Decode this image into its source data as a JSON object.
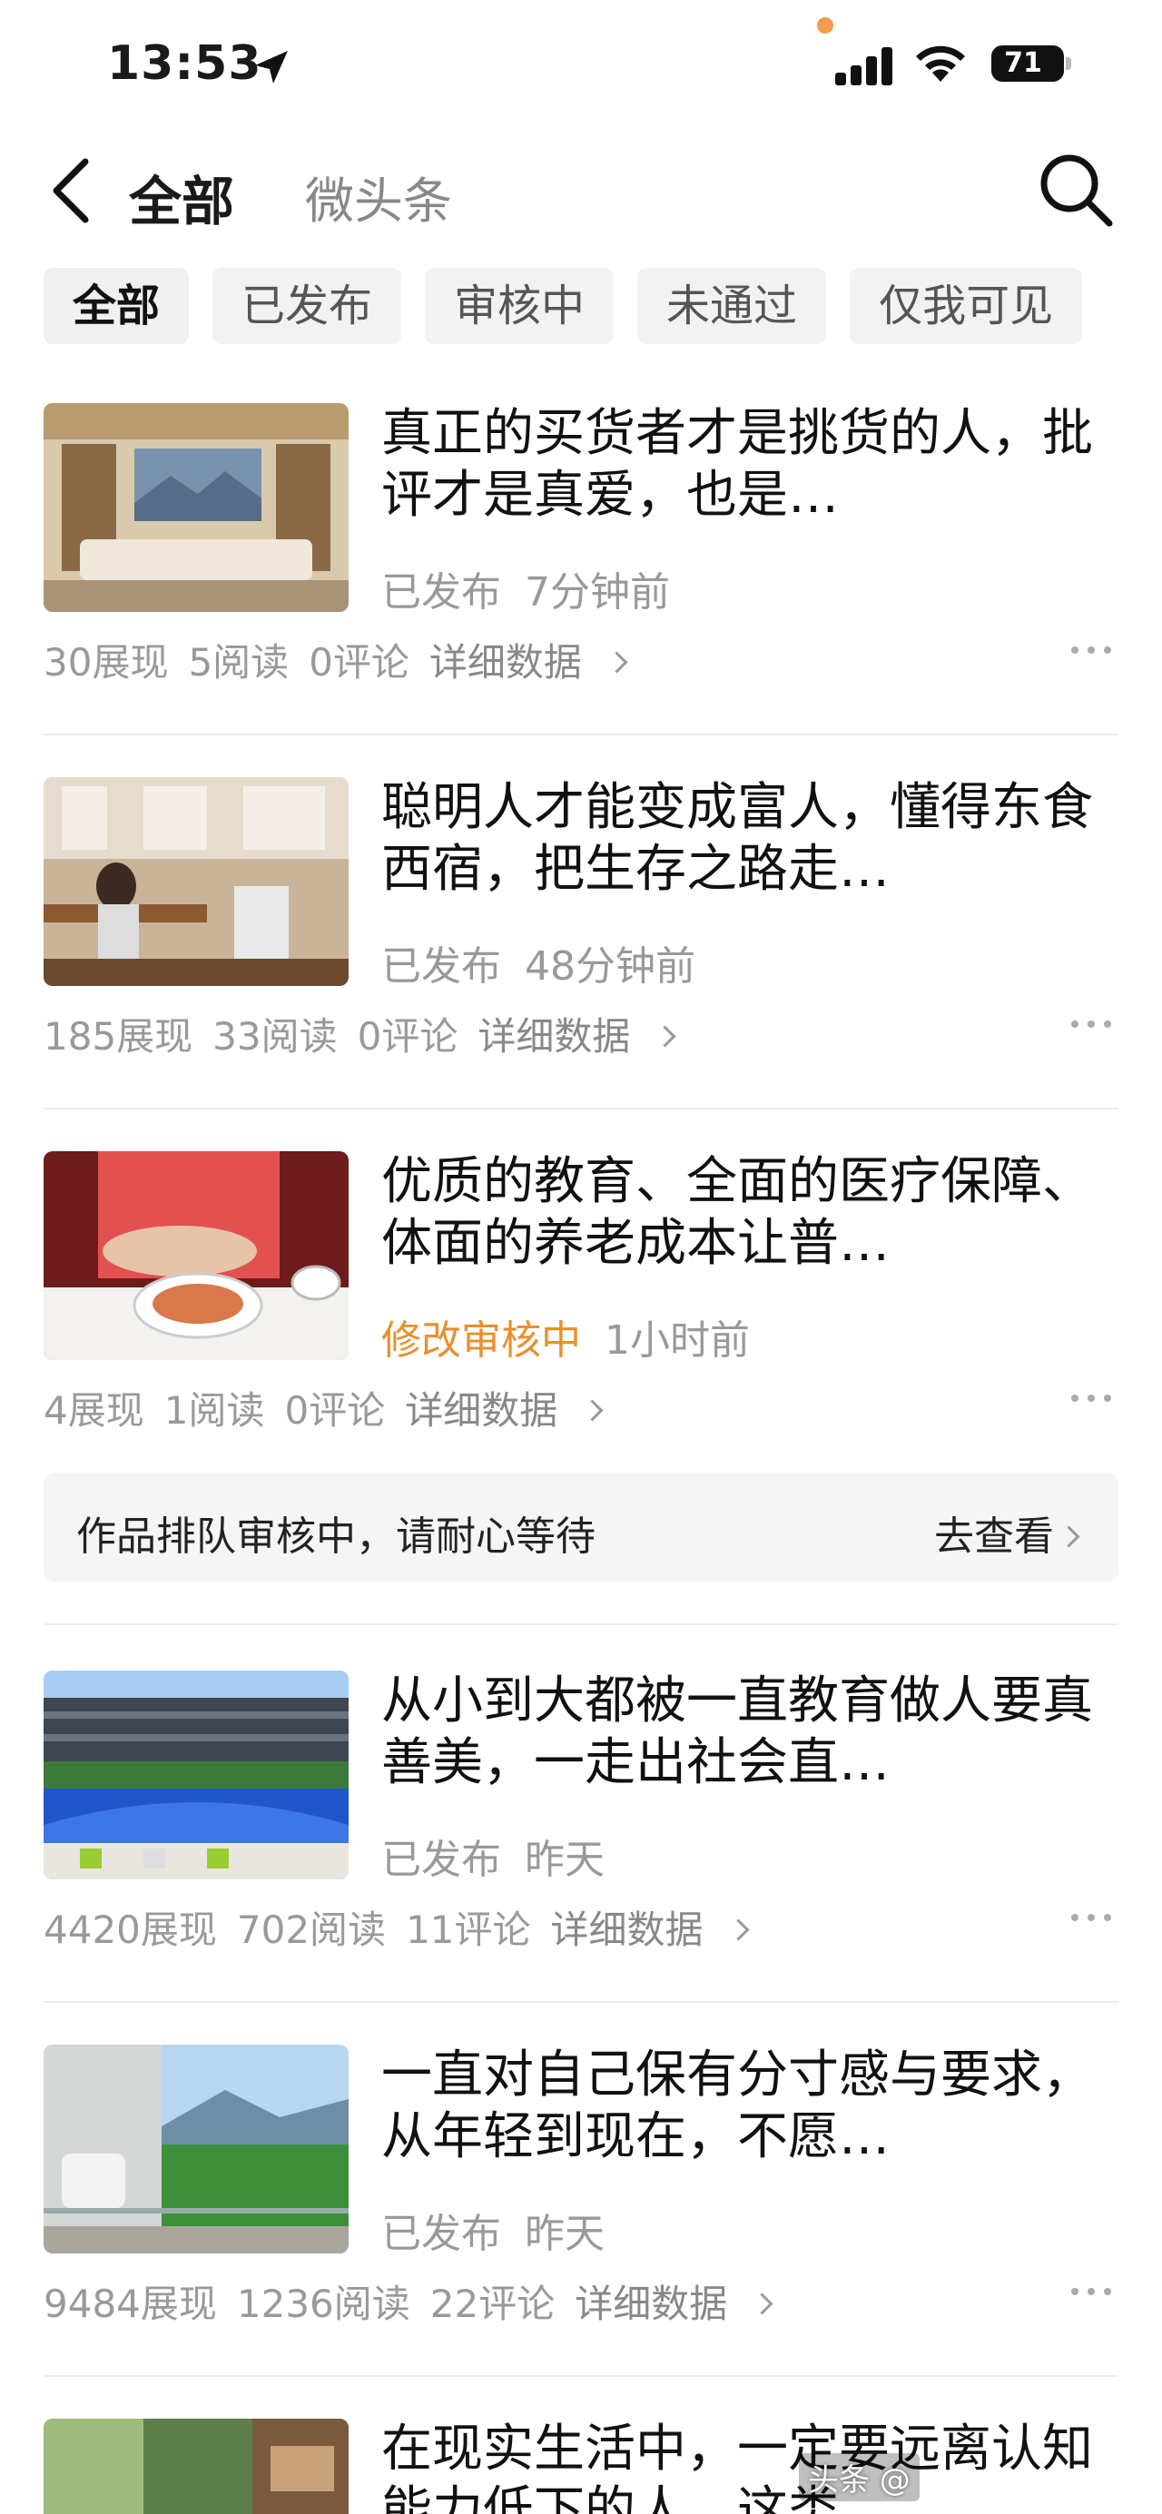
{
  "status_bar": {
    "time": "13:53",
    "battery": "71"
  },
  "header": {
    "title": "全部",
    "subtitle": "微头条"
  },
  "tabs": [
    "全部",
    "已发布",
    "审核中",
    "未通过",
    "仅我可见"
  ],
  "articles": [
    {
      "title": "真正的买货者才是挑货的人，批评才是真爱，也是…",
      "status": "已发布",
      "time": "7分钟前",
      "impressions": "30展现",
      "reads": "5阅读",
      "comments": "0评论",
      "detail": "详细数据"
    },
    {
      "title": "聪明人才能变成富人，懂得东食西宿，把生存之路走…",
      "status": "已发布",
      "time": "48分钟前",
      "impressions": "185展现",
      "reads": "33阅读",
      "comments": "0评论",
      "detail": "详细数据"
    },
    {
      "title": "优质的教育、全面的医疗保障、体面的养老成本让普…",
      "status": "修改审核中",
      "time": "1小时前",
      "impressions": "4展现",
      "reads": "1阅读",
      "comments": "0评论",
      "detail": "详细数据"
    },
    {
      "title": "从小到大都被一直教育做人要真善美，一走出社会直…",
      "status": "已发布",
      "time": "昨天",
      "impressions": "4420展现",
      "reads": "702阅读",
      "comments": "11评论",
      "detail": "详细数据"
    },
    {
      "title": "一直对自己保有分寸感与要求，从年轻到现在，不愿…",
      "status": "已发布",
      "time": "昨天",
      "impressions": "9484展现",
      "reads": "1236阅读",
      "comments": "22评论",
      "detail": "详细数据"
    },
    {
      "title": "在现实生活中，一定要远离认知能力低下的人，这类…"
    }
  ],
  "notice": {
    "text": "作品排队审核中，请耐心等待",
    "link": "去查看"
  },
  "watermark": "头条 @",
  "colors": {
    "pending": "#e8902e",
    "muted": "#999999",
    "badge_bg": "#f5f5f5"
  },
  "icons": [
    "back-arrow-icon",
    "search-icon",
    "more-dots-icon",
    "chevron-right-icon",
    "wifi-icon",
    "signal-icon",
    "battery-icon",
    "location-arrow-icon"
  ]
}
